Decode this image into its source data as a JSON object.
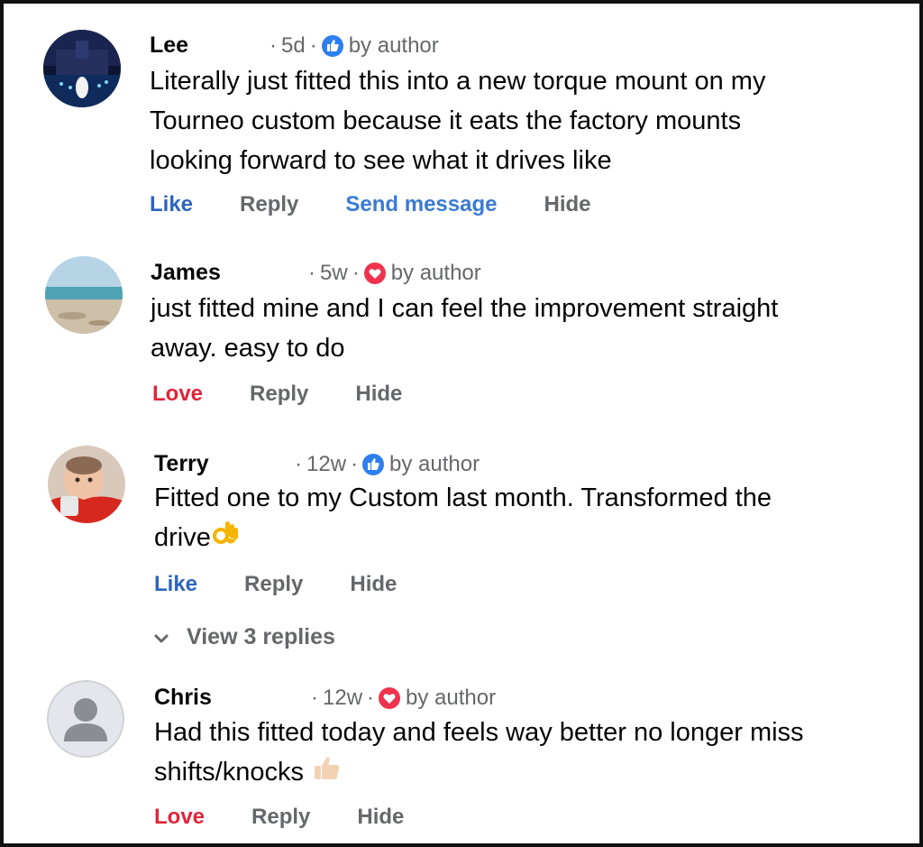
{
  "comments": [
    {
      "name": "Lee",
      "time": "5d",
      "by": "by author",
      "badge": "like",
      "lines": [
        "Literally just fitted this into a new torque mount on my",
        "Tourneo custom because it eats the factory mounts",
        "looking forward to see what it drives like"
      ],
      "actions": [
        "Like",
        "Reply",
        "Send message",
        "Hide"
      ]
    },
    {
      "name": "James",
      "time": "5w",
      "by": "by author",
      "badge": "love",
      "lines": [
        "just fitted mine and I can feel the improvement straight",
        "away. easy to do"
      ],
      "actions": [
        "Love",
        "Reply",
        "Hide"
      ]
    },
    {
      "name": "Terry",
      "time": "12w",
      "by": "by author",
      "badge": "like",
      "lines": [
        "Fitted one to my Custom last month. Transformed the",
        "drive"
      ],
      "emoji": "ok-hand-emoji",
      "actions": [
        "Like",
        "Reply",
        "Hide"
      ],
      "view_replies": "View 3 replies"
    },
    {
      "name": "Chris",
      "time": "12w",
      "by": "by author",
      "badge": "love",
      "lines": [
        "Had this fitted today and feels way better no longer miss",
        "shifts/knocks"
      ],
      "emoji": "thumbs-up-emoji",
      "actions": [
        "Love",
        "Reply",
        "Hide"
      ]
    }
  ],
  "colors": {
    "like_blue": "#2d64bc",
    "love_red": "#e0243a",
    "meta_grey": "#65676b",
    "text": "#050505"
  }
}
